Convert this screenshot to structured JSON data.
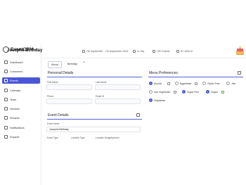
{
  "app": {
    "name": "EventCRM",
    "collapse_icon": "chevron-left-icon"
  },
  "sidebar": {
    "items": [
      {
        "label": "Dashboard",
        "icon": "dashboard-icon"
      },
      {
        "label": "Customers",
        "icon": "customers-icon"
      },
      {
        "label": "Events",
        "icon": "events-icon",
        "active": true
      },
      {
        "label": "Calendar",
        "icon": "calendar-icon"
      },
      {
        "label": "Team",
        "icon": "team-icon"
      },
      {
        "label": "Vendors",
        "icon": "vendors-icon"
      },
      {
        "label": "Recipes",
        "icon": "recipes-icon"
      },
      {
        "label": "Notifications",
        "icon": "bell-icon"
      },
      {
        "label": "Support",
        "icon": "support-icon"
      }
    ]
  },
  "header": {
    "title": "Josephs Birthday",
    "date": "7th September - 7th September 2024",
    "location": "In City",
    "guests": "150 Guests",
    "id": "ID: #0CLVr"
  },
  "tabs": {
    "about": "About",
    "birthday": "Birthday",
    "add": "+"
  },
  "personal": {
    "title": "Personal Details",
    "first_name_label": "First Name",
    "first_name_value": "",
    "last_name_label": "Last Name",
    "last_name_value": "",
    "phone_label": "Phone",
    "phone_value": "",
    "email_label": "Email ID",
    "email_value": ""
  },
  "event_details": {
    "title": "Event Details",
    "event_name_label": "Event Name",
    "event_name_value": "Josephs Birthday",
    "event_type_label": "Event Type",
    "location_type_label": "Location Type",
    "location_budget_label": "Location Budget/person"
  },
  "menu_prefs": {
    "title": "Menu Preferences",
    "items": [
      {
        "label": "Alcohol",
        "checked": true
      },
      {
        "label": "Eggetarian",
        "checked": false
      },
      {
        "label": "Gluten Free",
        "checked": false
      },
      {
        "label": "Jain",
        "checked": false
      },
      {
        "label": "Non Vegetarian",
        "checked": false
      },
      {
        "label": "Sugar Free",
        "checked": true
      },
      {
        "label": "Vegan",
        "checked": true
      },
      {
        "label": "Vegetarian",
        "checked": true
      }
    ]
  },
  "colors": {
    "accent": "#4b57d8"
  }
}
